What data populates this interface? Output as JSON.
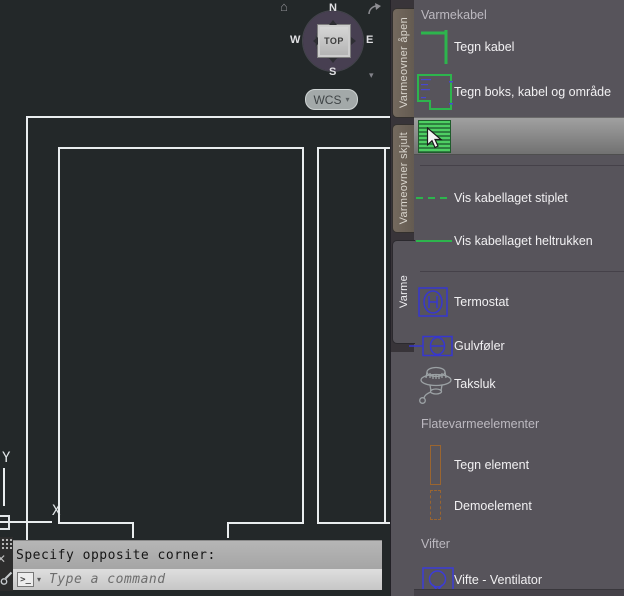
{
  "viewcube": {
    "north": "N",
    "west": "W",
    "east": "E",
    "south": "S",
    "top_face": "TOP",
    "wcs_label": "WCS"
  },
  "ucs": {
    "x_label": "X",
    "y_label": "Y"
  },
  "command_line": {
    "history": "Specify opposite corner:",
    "prompt_symbol": ">_",
    "placeholder": "Type a command"
  },
  "panel": {
    "tabs": [
      {
        "label": "Varmeovner åpen",
        "active": false
      },
      {
        "label": "Varmeovner skjult",
        "active": false
      },
      {
        "label": "Varme",
        "active": true
      }
    ],
    "sections": {
      "varmekabel": "Varmekabel",
      "flatevarme": "Flatevarmeelementer",
      "vifter": "Vifter"
    },
    "items": {
      "tegn_kabel": "Tegn kabel",
      "tegn_boks": "Tegn boks, kabel og område",
      "vis_stiplet": "Vis kabellaget stiplet",
      "vis_heltrukken": "Vis kabellaget heltrukken",
      "termostat": "Termostat",
      "gulvfoler": "Gulvføler",
      "taksluk": "Taksluk",
      "tegn_element": "Tegn element",
      "demoelement": "Demoelement",
      "vifte": "Vifte - Ventilator"
    }
  },
  "colors": {
    "canvas_bg": "#232829",
    "panel_bg": "#57545b",
    "accent_green": "#2db54d",
    "accent_blue": "#3737cf",
    "accent_orange": "#9a6530",
    "hover_row": "#8e8e8e"
  }
}
